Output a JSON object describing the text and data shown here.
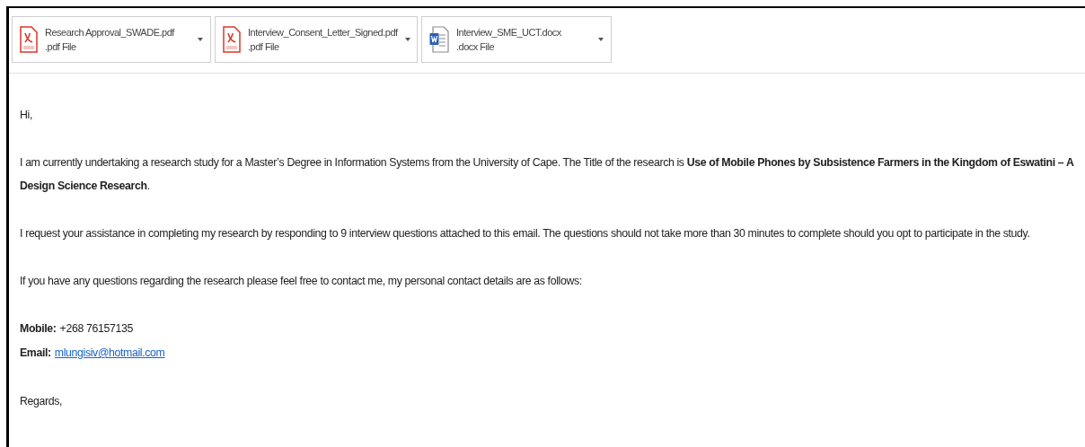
{
  "attachments": [
    {
      "kind": "pdf",
      "name": "Research Approval_SWADE.pdf",
      "type": ".pdf File"
    },
    {
      "kind": "pdf",
      "name": "Interview_Consent_Letter_Signed.pdf",
      "type": ".pdf File"
    },
    {
      "kind": "docx",
      "name": "Interview_SME_UCT.docx",
      "type": ".docx File"
    }
  ],
  "body": {
    "greeting": "Hi,",
    "paragraphs": [
      "I am currently undertaking a research study for a Master’s Degree in Information Systems from the University of Cape.  The Title of the research is **Use of Mobile Phones by Subsistence Farmers in the Kingdom of Eswatini – A Design Science Research**.",
      "I request your assistance in completing my research by responding to 9 interview questions attached to this email.  The questions should not take more than 30 minutes to complete should you opt to participate in the study.",
      "If you have any questions regarding the research please feel free to contact me, my personal contact details are as follows:"
    ],
    "contacts": [
      {
        "kind": "text",
        "label": "Mobile:",
        "value": "+268 76157135"
      },
      {
        "kind": "link",
        "label": "Email:",
        "value": "mlungisiv@hotmail.com"
      }
    ],
    "closing": "Regards,"
  }
}
